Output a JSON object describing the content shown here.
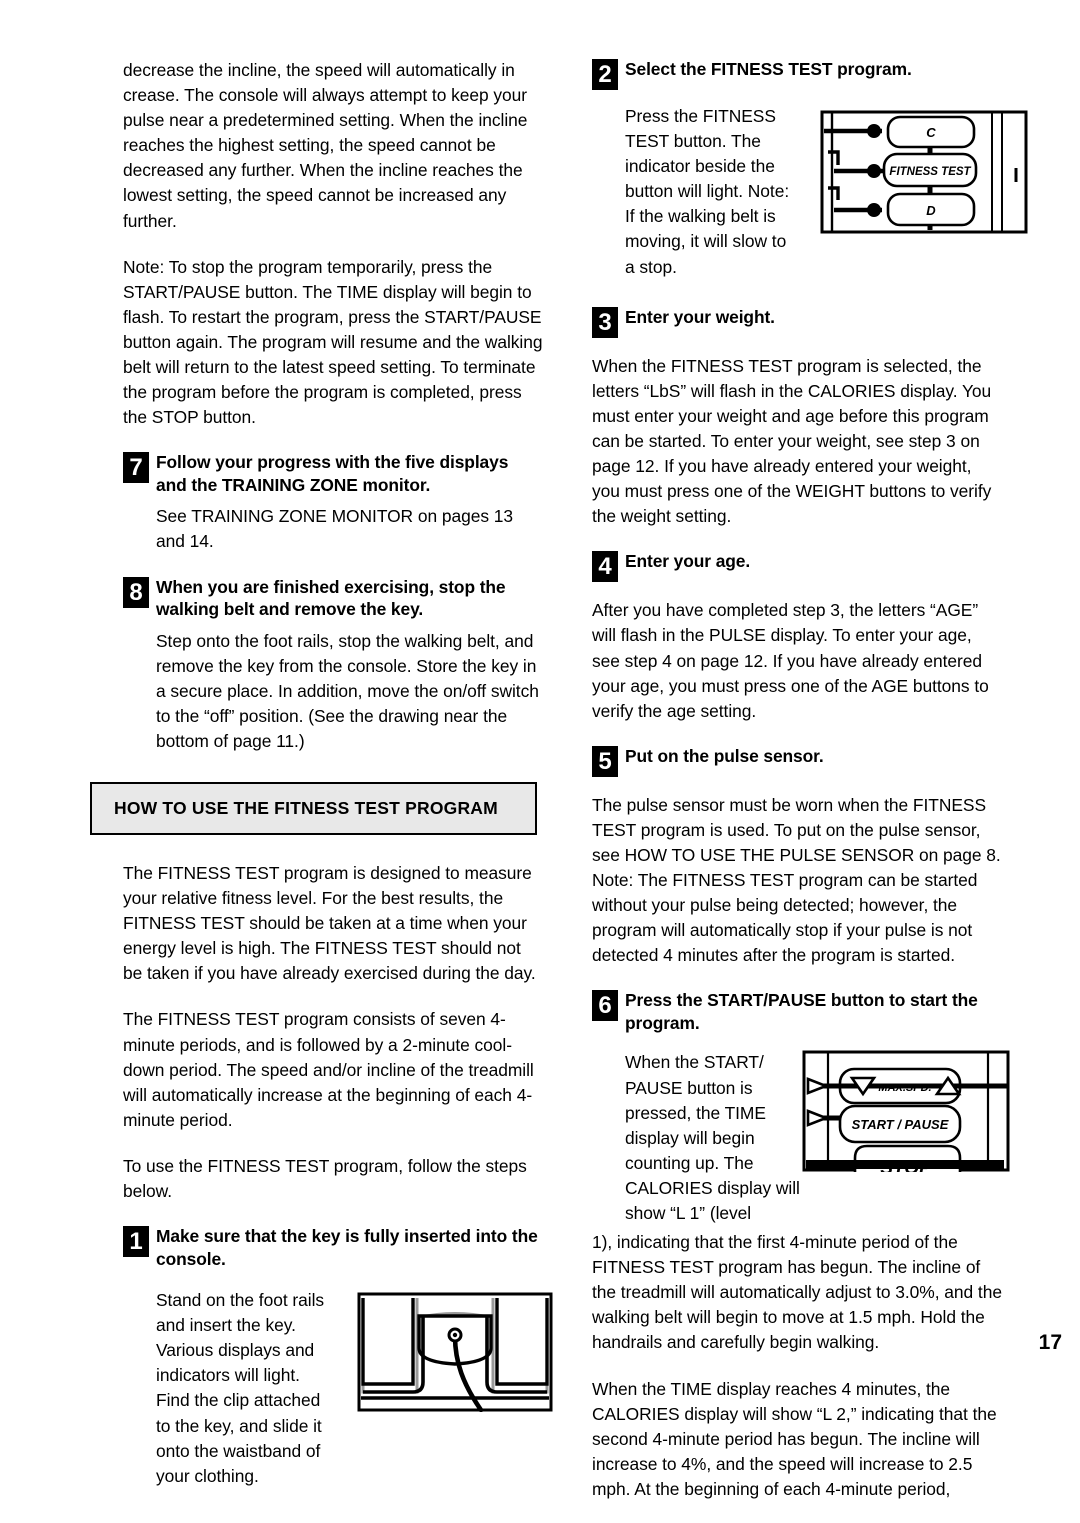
{
  "page": {
    "number": "17",
    "left_column": {
      "paragraphs": [
        "decrease the incline, the speed will automatically in crease. The console will always attempt to keep your pulse near a predetermined setting. When the incline reaches the highest setting, the speed cannot be decreased any further. When the incline reaches the lowest setting, the speed cannot be increased any further.",
        "Note: To stop the program temporarily, press the START/PAUSE button. The TIME display will begin to flash. To restart the program, press the START/PAUSE button again. The program will resume and the walking belt will return to the latest speed setting. To terminate the program before the program is completed, press the STOP button."
      ],
      "step7": {
        "number": "7",
        "title": "Follow your progress with the five displays and the TRAINING ZONE monitor.",
        "body": "See TRAINING ZONE MONITOR on pages 13 and 14."
      },
      "step8": {
        "number": "8",
        "title": "When you are finished exercising, stop the walking belt and remove the key.",
        "body": "Step onto the foot rails, stop the walking belt, and remove the key from the console. Store the key in a secure place. In addition, move the on/off switch to the “off” position. (See the drawing near the bottom of page 11.)"
      },
      "banner": "HOW TO USE THE FITNESS TEST PROGRAM",
      "intro_paragraphs": [
        "The FITNESS TEST program is designed to measure your relative fitness level. For the best results, the FITNESS TEST should be taken at a time when your energy level is high. The FITNESS TEST should not be taken if you have already exercised during the day.",
        "The FITNESS TEST program consists of seven 4-minute periods, and is followed by a 2-minute cool-down period. The speed and/or incline of the treadmill will automatically increase at the beginning of each 4-minute period.",
        "To use the FITNESS TEST program, follow the steps below."
      ],
      "step1": {
        "number": "1",
        "title": "Make sure that the key is fully inserted into the console.",
        "body": "Stand on the foot rails and insert the key. Various displays and indicators will light. Find the clip attached to the key, and slide it onto the waistband of your clothing."
      }
    },
    "right_column": {
      "step2": {
        "number": "2",
        "title": "Select the FITNESS TEST program.",
        "body": "Press the FITNESS TEST button. The indicator beside the button will light. Note: If the walking belt is moving, it will slow to a stop."
      },
      "step3": {
        "number": "3",
        "title": "Enter your weight.",
        "body": "When the FITNESS TEST program is selected, the letters “LbS” will flash in the CALORIES display. You must enter your weight and age before this program can be started. To enter your weight, see step 3 on page 12. If you have already entered your weight, you must press one of the WEIGHT buttons to verify the weight setting."
      },
      "step4": {
        "number": "4",
        "title": "Enter your age.",
        "body": "After you have completed step 3, the letters “AGE” will flash in the PULSE display. To enter your age, see step 4 on page 12. If you have already entered your age, you must press one of the AGE buttons to verify the age setting."
      },
      "step5": {
        "number": "5",
        "title": "Put on the pulse sensor.",
        "body": "The pulse sensor must be worn when the FITNESS TEST program is used. To put on the pulse sensor, see HOW TO USE THE PULSE SENSOR on page 8. Note: The FITNESS TEST program can be started without your pulse being detected; however, the program will automatically stop if your pulse is not detected 4 minutes after the program is started."
      },
      "step6": {
        "number": "6",
        "title": "Press the START/PAUSE button to start the program.",
        "body_narrow": "When the START/ PAUSE button is pressed, the TIME display will begin counting up. The CALORIES display will show “L 1” (level",
        "body_wrap": "1), indicating that the first 4-minute period of the FITNESS TEST program has begun. The incline of the treadmill will automatically adjust to 3.0%, and the walking belt will begin to move at 1.5 mph. Hold the handrails and carefully begin walking.",
        "body_last": "When the TIME display reaches 4 minutes, the CALORIES display will show “L 2,” indicating that the second 4-minute period has begun. The incline will increase to 4%, and the speed will increase to 2.5 mph. At the beginning of each 4-minute period,"
      }
    },
    "figures": {
      "console_buttons": {
        "name": "console-button-panel-diagram",
        "labels": [
          "C",
          "FITNESS TEST",
          "D"
        ]
      },
      "start_pause": {
        "name": "start-pause-button-diagram",
        "labels": [
          "MAX.SPD.",
          "START / PAUSE",
          "STOP"
        ]
      },
      "key_insert": {
        "name": "key-insertion-diagram"
      }
    }
  }
}
